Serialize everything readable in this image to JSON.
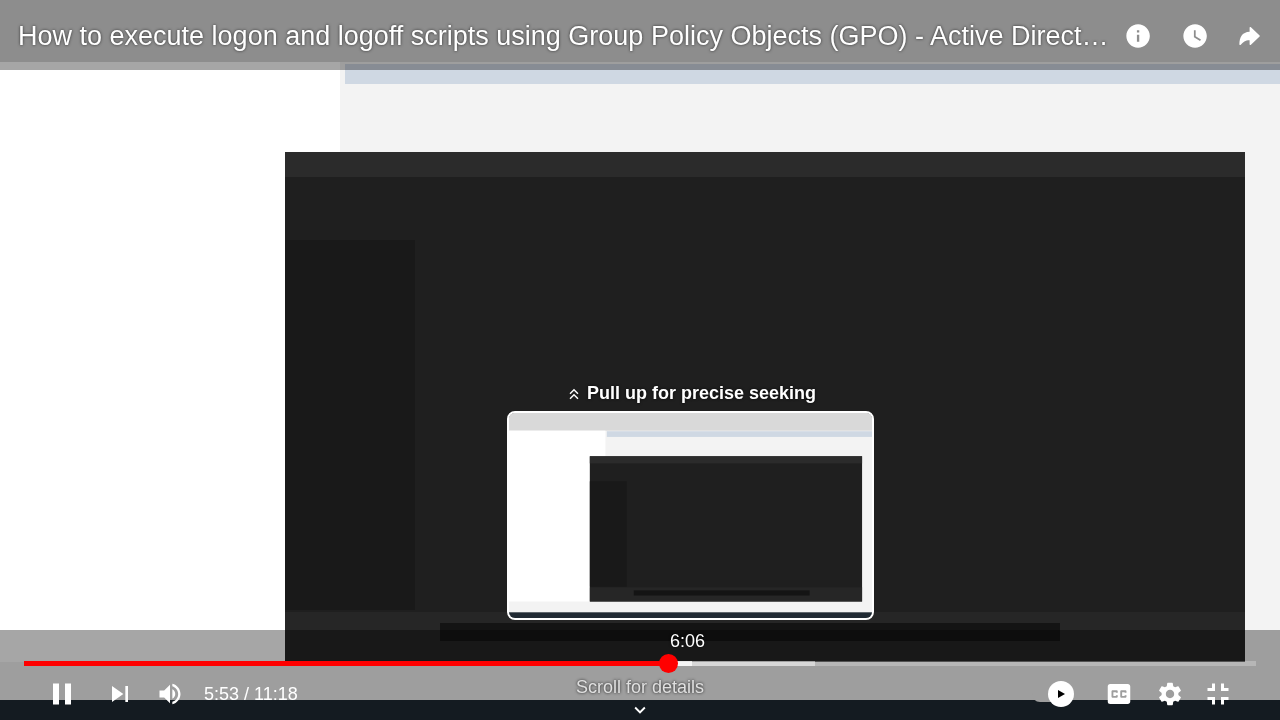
{
  "video": {
    "kind": "picture",
    "title": "How to execute logon and logoff scripts using Group Policy Objects (GPO) - Active Direct…"
  },
  "seek": {
    "hint": "Pull up for precise seeking",
    "preview": {
      "kind": "picture",
      "time": "6:06"
    }
  },
  "progress": {
    "level": 0.523,
    "buffer": {
      "level": 0.642
    },
    "hover": {
      "level": 0.542
    }
  },
  "time": "5:53 / 11:18",
  "autoplay": {
    "on": true
  },
  "details_hint": "Scroll for details"
}
